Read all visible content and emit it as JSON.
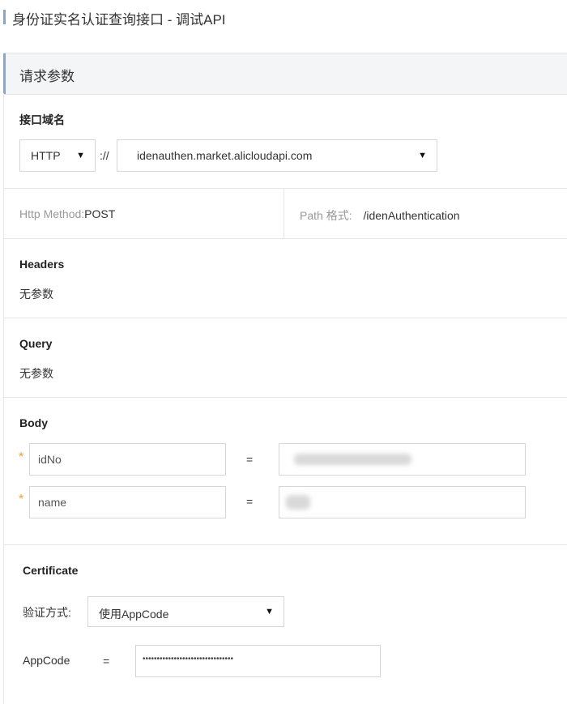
{
  "title": "身份证实名认证查询接口 - 调试API",
  "section_header": "请求参数",
  "domain": {
    "label": "接口域名",
    "protocol": "HTTP",
    "separator": "://",
    "host": "idenauthen.market.alicloudapi.com"
  },
  "method": {
    "label": "Http Method:",
    "value": "POST",
    "path_label": "Path 格式:",
    "path_value": "/idenAuthentication"
  },
  "headers": {
    "title": "Headers",
    "empty": "无参数"
  },
  "query": {
    "title": "Query",
    "empty": "无参数"
  },
  "body": {
    "title": "Body",
    "params": [
      {
        "name": "idNo",
        "required": "*",
        "eq": "="
      },
      {
        "name": "name",
        "required": "*",
        "eq": "="
      }
    ]
  },
  "certificate": {
    "title": "Certificate",
    "method_label": "验证方式:",
    "method_value": "使用AppCode",
    "appcode_label": "AppCode",
    "eq": "=",
    "appcode_value": "••••••••••••••••••••••••••••••••"
  },
  "colors": {
    "accent_bar": "#8aa6c8",
    "required_star": "#f0a030"
  }
}
